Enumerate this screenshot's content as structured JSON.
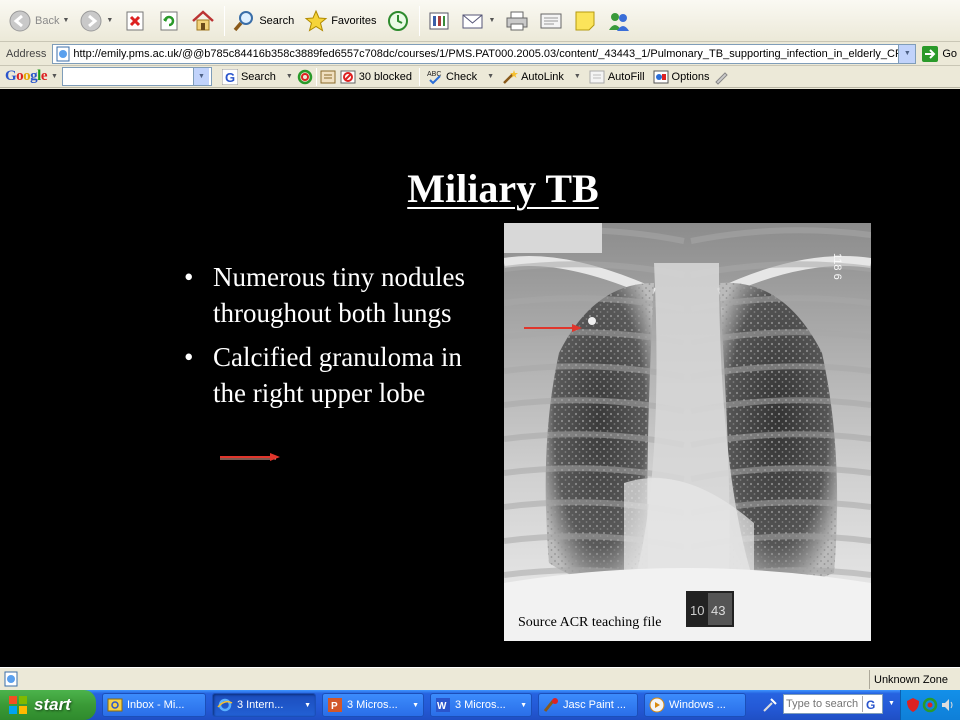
{
  "toolbar": {
    "back_label": "Back",
    "search_label": "Search",
    "favorites_label": "Favorites"
  },
  "address": {
    "label": "Address",
    "url": "http://emily.pms.ac.uk/@@b785c84416b358c3889fed6557c708dc/courses/1/PMS.PAT000.2005.03/content/_43443_1/Pulmonary_TB_supporting_infection_in_elderly_CPC",
    "go_label": "Go"
  },
  "google_bar": {
    "logo": [
      "G",
      "o",
      "o",
      "g",
      "l",
      "e"
    ],
    "search_label": "Search",
    "blocked_label": "30 blocked",
    "check_label": "Check",
    "autolink_label": "AutoLink",
    "autofill_label": "AutoFill",
    "options_label": "Options"
  },
  "slide": {
    "title": "Miliary TB",
    "bullets": [
      "Numerous tiny nodules throughout both lungs",
      "Calcified granuloma in the right upper lobe"
    ],
    "source": "Source ACR teaching file",
    "film_marker": "10",
    "film_marker2": "43",
    "film_corner": "118 6"
  },
  "status_bar": {
    "zone": "Unknown Zone"
  },
  "taskbar": {
    "start_label": "start",
    "tasks": [
      {
        "label": "Inbox - Mi...",
        "count": ""
      },
      {
        "label": "Intern...",
        "count": "3"
      },
      {
        "label": "Micros...",
        "count": "3"
      },
      {
        "label": "Micros...",
        "count": "3"
      },
      {
        "label": "Jasc Paint ...",
        "count": ""
      },
      {
        "label": "Windows ...",
        "count": ""
      }
    ],
    "search_placeholder": "Type to search"
  },
  "colors": {
    "arrow": "#e0362c",
    "slide_bg": "#000000",
    "taskbar_blue": "#2459d6"
  }
}
